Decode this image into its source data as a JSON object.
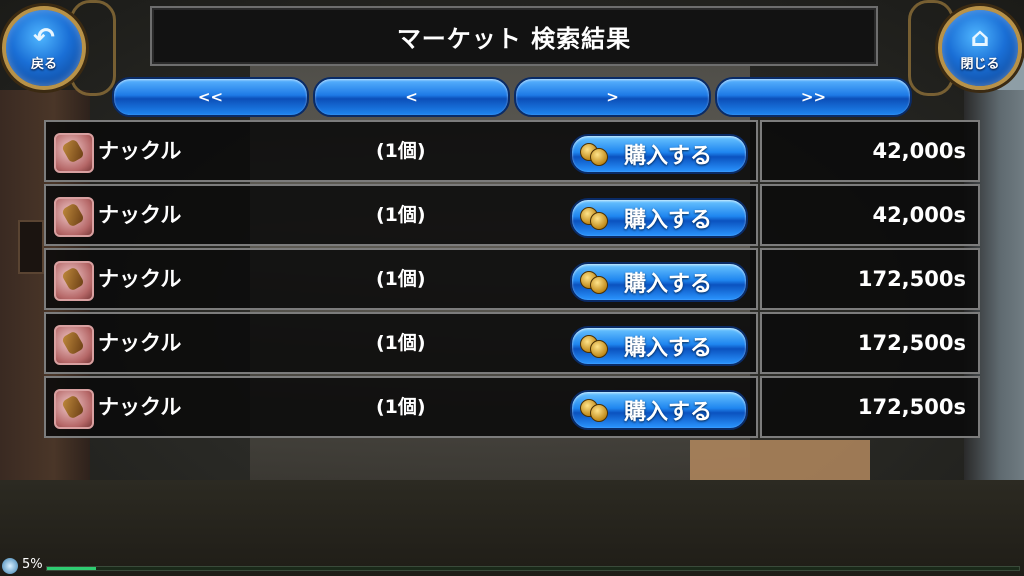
{
  "header": {
    "title": "マーケット 検索結果",
    "back_label": "戻る",
    "close_label": "閉じる"
  },
  "pager": {
    "first": "<<",
    "prev": "<",
    "next": ">",
    "last": ">>"
  },
  "rows": [
    {
      "name": "ナックル",
      "qty": "(1個)",
      "buy": "購入する",
      "price": "42,000s"
    },
    {
      "name": "ナックル",
      "qty": "(1個)",
      "buy": "購入する",
      "price": "42,000s"
    },
    {
      "name": "ナックル",
      "qty": "(1個)",
      "buy": "購入する",
      "price": "172,500s"
    },
    {
      "name": "ナックル",
      "qty": "(1個)",
      "buy": "購入する",
      "price": "172,500s"
    },
    {
      "name": "ナックル",
      "qty": "(1個)",
      "buy": "購入する",
      "price": "172,500s"
    }
  ],
  "status": {
    "percent_text": "5%",
    "progress": 0.05
  },
  "icons": {
    "back": "back-arrow-icon",
    "close": "home-icon",
    "item": "knuckle-icon",
    "coin": "coin-icon",
    "status": "globe-icon"
  },
  "colors": {
    "button_blue": "#1e7ae6",
    "frame_gold": "#b89248",
    "row_bg": "#0a0a0a"
  }
}
